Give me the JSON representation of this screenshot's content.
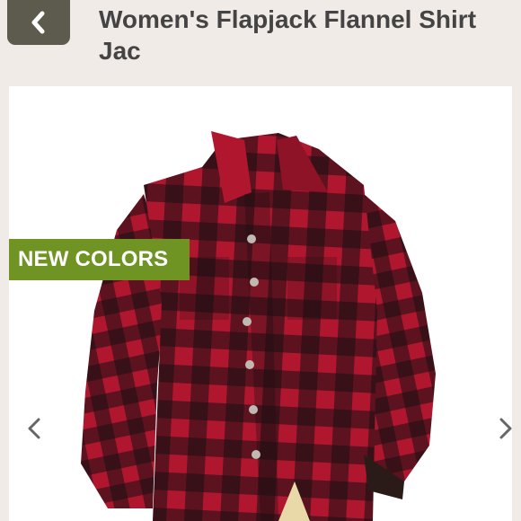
{
  "header": {
    "title": "Women's Flapjack Flannel Shirt Jac",
    "back_icon": "chevron-left-icon"
  },
  "product": {
    "badge_label": "NEW COLORS",
    "image_subject": "red and black buffalo-check flannel shirt jacket",
    "carousel": {
      "prev_icon": "chevron-left-icon",
      "next_icon": "chevron-right-icon"
    }
  },
  "colors": {
    "page_bg": "#f1ebe7",
    "back_button": "#5d5b4e",
    "badge": "#6f9424",
    "plaid_red": "#b0172e",
    "plaid_black": "#1a0f12",
    "title_text": "#444444"
  }
}
